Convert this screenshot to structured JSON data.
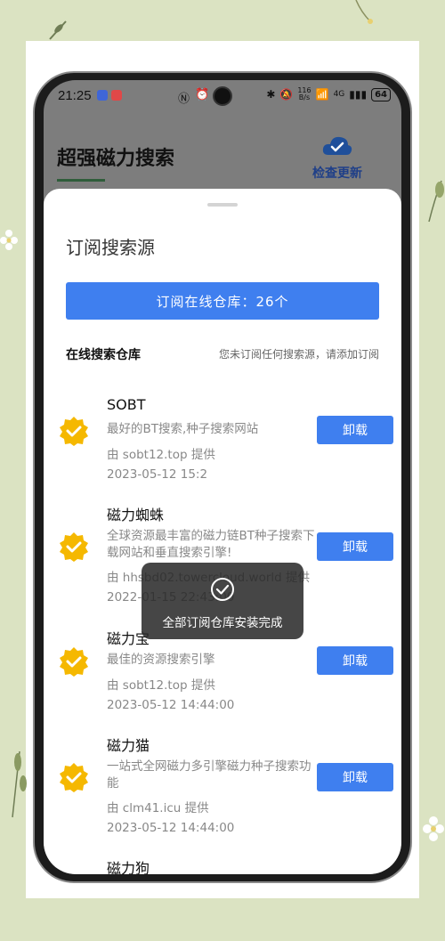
{
  "status_bar": {
    "time": "21:25",
    "speed": "116\nB/s",
    "network": "4G",
    "battery": "64"
  },
  "app": {
    "title": "超强磁力搜索",
    "update_label": "检查更新"
  },
  "sheet": {
    "title": "订阅搜索源",
    "subscribe_button": "订阅在线仓库：26个",
    "section_label": "在线搜索仓库",
    "section_hint": "您未订阅任何搜索源，请添加订阅"
  },
  "items": [
    {
      "name": "SOBT",
      "desc": "最好的BT搜索,种子搜索网站",
      "provider": "由 sobt12.top 提供",
      "date": "2023-05-12 15:2",
      "action": "卸载"
    },
    {
      "name": "磁力蜘蛛",
      "desc": "全球资源最丰富的磁力链BT种子搜索下载网站和垂直搜索引擎!",
      "provider": "由 hhsbd02.towercloud.world 提供",
      "date": "2022-01-15 22:43:00",
      "action": "卸载"
    },
    {
      "name": "磁力宝",
      "desc": "最佳的资源搜索引擎",
      "provider": "由 sobt12.top 提供",
      "date": "2023-05-12 14:44:00",
      "action": "卸载"
    },
    {
      "name": "磁力猫",
      "desc": "一站式全网磁力多引擎磁力种子搜索功能",
      "provider": "由 clm41.icu 提供",
      "date": "2023-05-12 14:44:00",
      "action": "卸载"
    },
    {
      "name": "磁力狗"
    }
  ],
  "toast": {
    "message": "全部订阅仓库安装完成"
  },
  "colors": {
    "accent": "#3f7fef",
    "check": "#f5b800",
    "background": "#dbe3c2"
  }
}
